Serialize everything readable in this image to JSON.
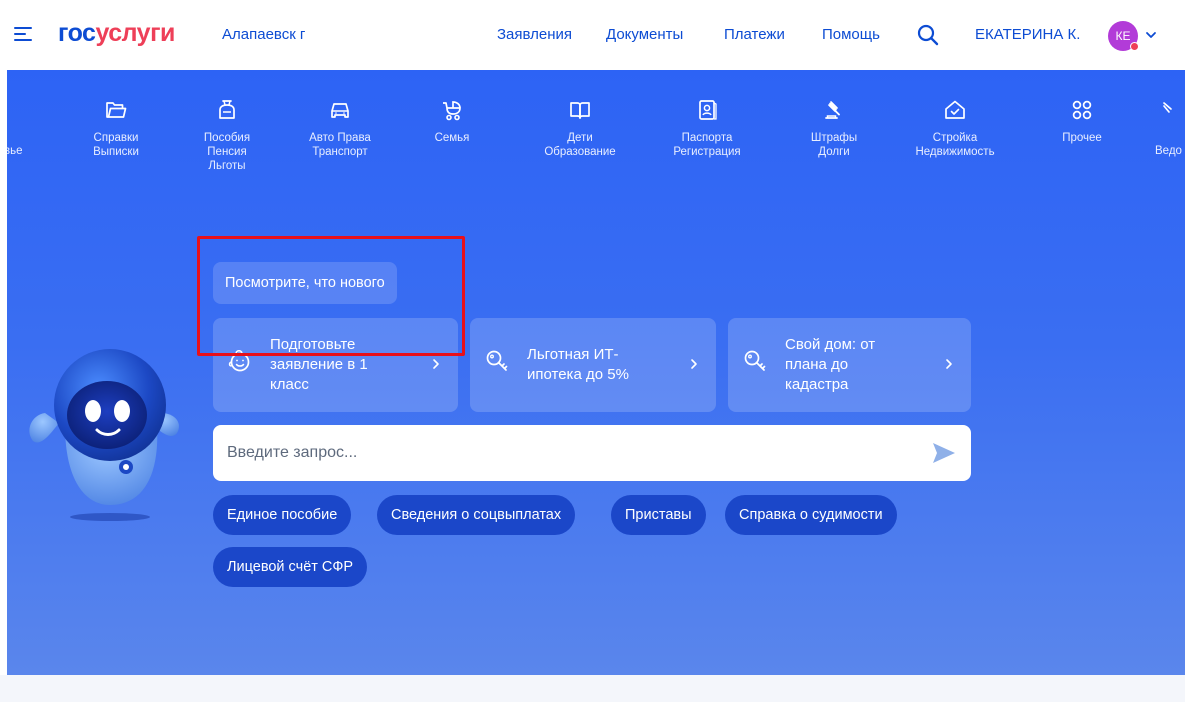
{
  "header": {
    "logo_part1": "гос",
    "logo_part2": "услуги",
    "city": "Алапаевск г",
    "nav": [
      "Заявления",
      "Документы",
      "Платежи",
      "Помощь"
    ],
    "user_name": "ЕКАТЕРИНА К.",
    "avatar_initials": "КЕ"
  },
  "categories": {
    "edge_left": "вье",
    "edge_right": "Ведо",
    "items": [
      {
        "icon": "folder-icon",
        "label": "Справки\nВыписки"
      },
      {
        "icon": "wallet-icon",
        "label": "Пособия\nПенсия\nЛьготы"
      },
      {
        "icon": "car-icon",
        "label": "Авто Права\nТранспорт"
      },
      {
        "icon": "stroller-icon",
        "label": "Семья"
      },
      {
        "icon": "book-icon",
        "label": "Дети\nОбразование"
      },
      {
        "icon": "passport-icon",
        "label": "Паспорта\nРегистрация"
      },
      {
        "icon": "gavel-icon",
        "label": "Штрафы\nДолги"
      },
      {
        "icon": "house-icon",
        "label": "Стройка\nНедвижимость"
      },
      {
        "icon": "grid-icon",
        "label": "Прочее"
      }
    ]
  },
  "whats_new": "Посмотрите, что нового",
  "promos": [
    {
      "text": "Подготовьте заявление в 1 класс"
    },
    {
      "text": "Льготная ИТ-ипотека до 5%"
    },
    {
      "text": "Свой дом: от плана до кадастра"
    }
  ],
  "search": {
    "placeholder": "Введите запрос..."
  },
  "chips": [
    "Единое пособие",
    "Сведения о соцвыплатах",
    "Приставы",
    "Справка о судимости",
    "Лицевой счёт СФР"
  ],
  "colors": {
    "brand_blue": "#0d4cd3",
    "brand_red": "#ee3f58",
    "hero_blue": "#2d63f5",
    "chip_blue": "#1b47c9",
    "highlight_red": "#e8101a"
  }
}
